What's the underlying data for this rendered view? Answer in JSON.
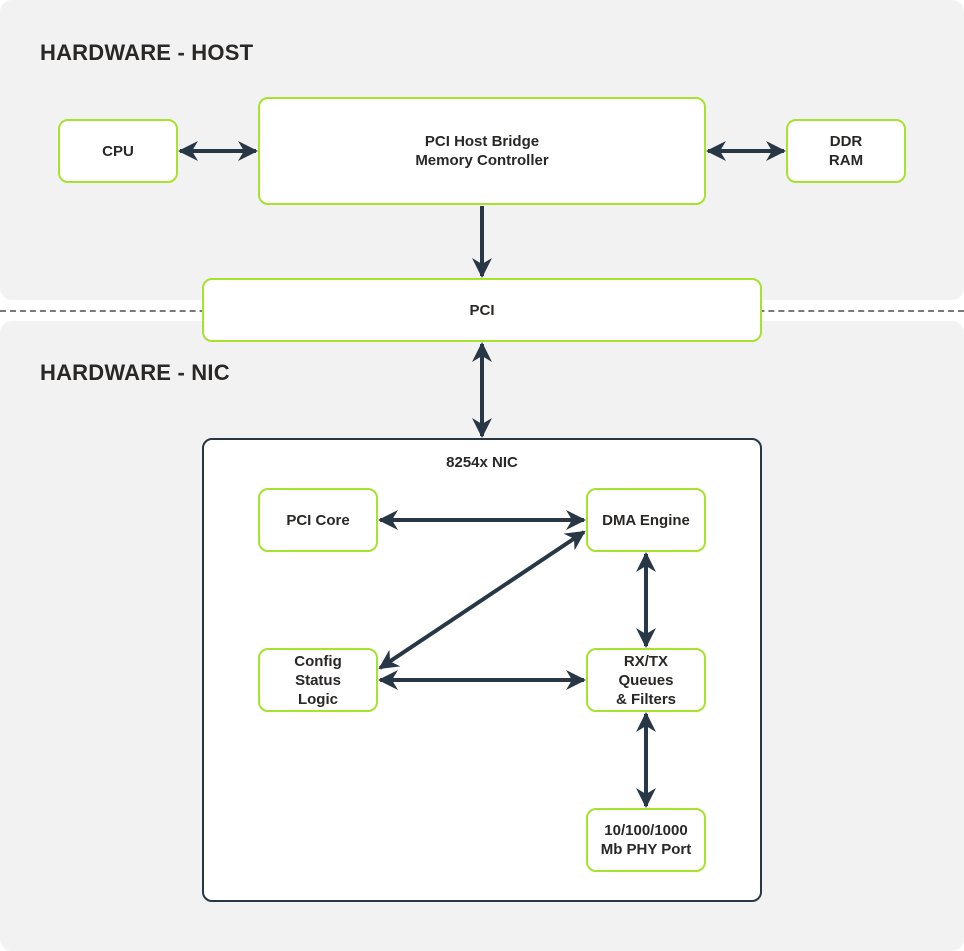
{
  "sections": {
    "host": {
      "title": "HARDWARE - HOST"
    },
    "nic": {
      "title": "HARDWARE - NIC"
    }
  },
  "nodes": {
    "cpu": {
      "label": "CPU"
    },
    "bridge": {
      "label": "PCI Host Bridge\nMemory Controller"
    },
    "ddr": {
      "label": "DDR\nRAM"
    },
    "pci": {
      "label": "PCI"
    },
    "nic_container": {
      "label": "8254x NIC"
    },
    "pci_core": {
      "label": "PCI Core"
    },
    "dma": {
      "label": "DMA Engine"
    },
    "config": {
      "label": "Config\nStatus\nLogic"
    },
    "rxtx": {
      "label": "RX/TX\nQueues\n& Filters"
    },
    "phy": {
      "label": "10/100/1000\nMb PHY Port"
    }
  },
  "edges": [
    {
      "from": "cpu",
      "to": "bridge",
      "direction": "both"
    },
    {
      "from": "bridge",
      "to": "ddr",
      "direction": "both"
    },
    {
      "from": "bridge",
      "to": "pci",
      "direction": "forward"
    },
    {
      "from": "pci",
      "to": "nic_container",
      "direction": "both"
    },
    {
      "from": "pci_core",
      "to": "dma",
      "direction": "both"
    },
    {
      "from": "dma",
      "to": "config",
      "direction": "both"
    },
    {
      "from": "config",
      "to": "rxtx",
      "direction": "both"
    },
    {
      "from": "dma",
      "to": "rxtx",
      "direction": "both"
    },
    {
      "from": "rxtx",
      "to": "phy",
      "direction": "both"
    }
  ],
  "colors": {
    "node_border": "#a6e22e",
    "arrow": "#273746",
    "panel": "#f2f2f2",
    "text": "#2a2826"
  }
}
